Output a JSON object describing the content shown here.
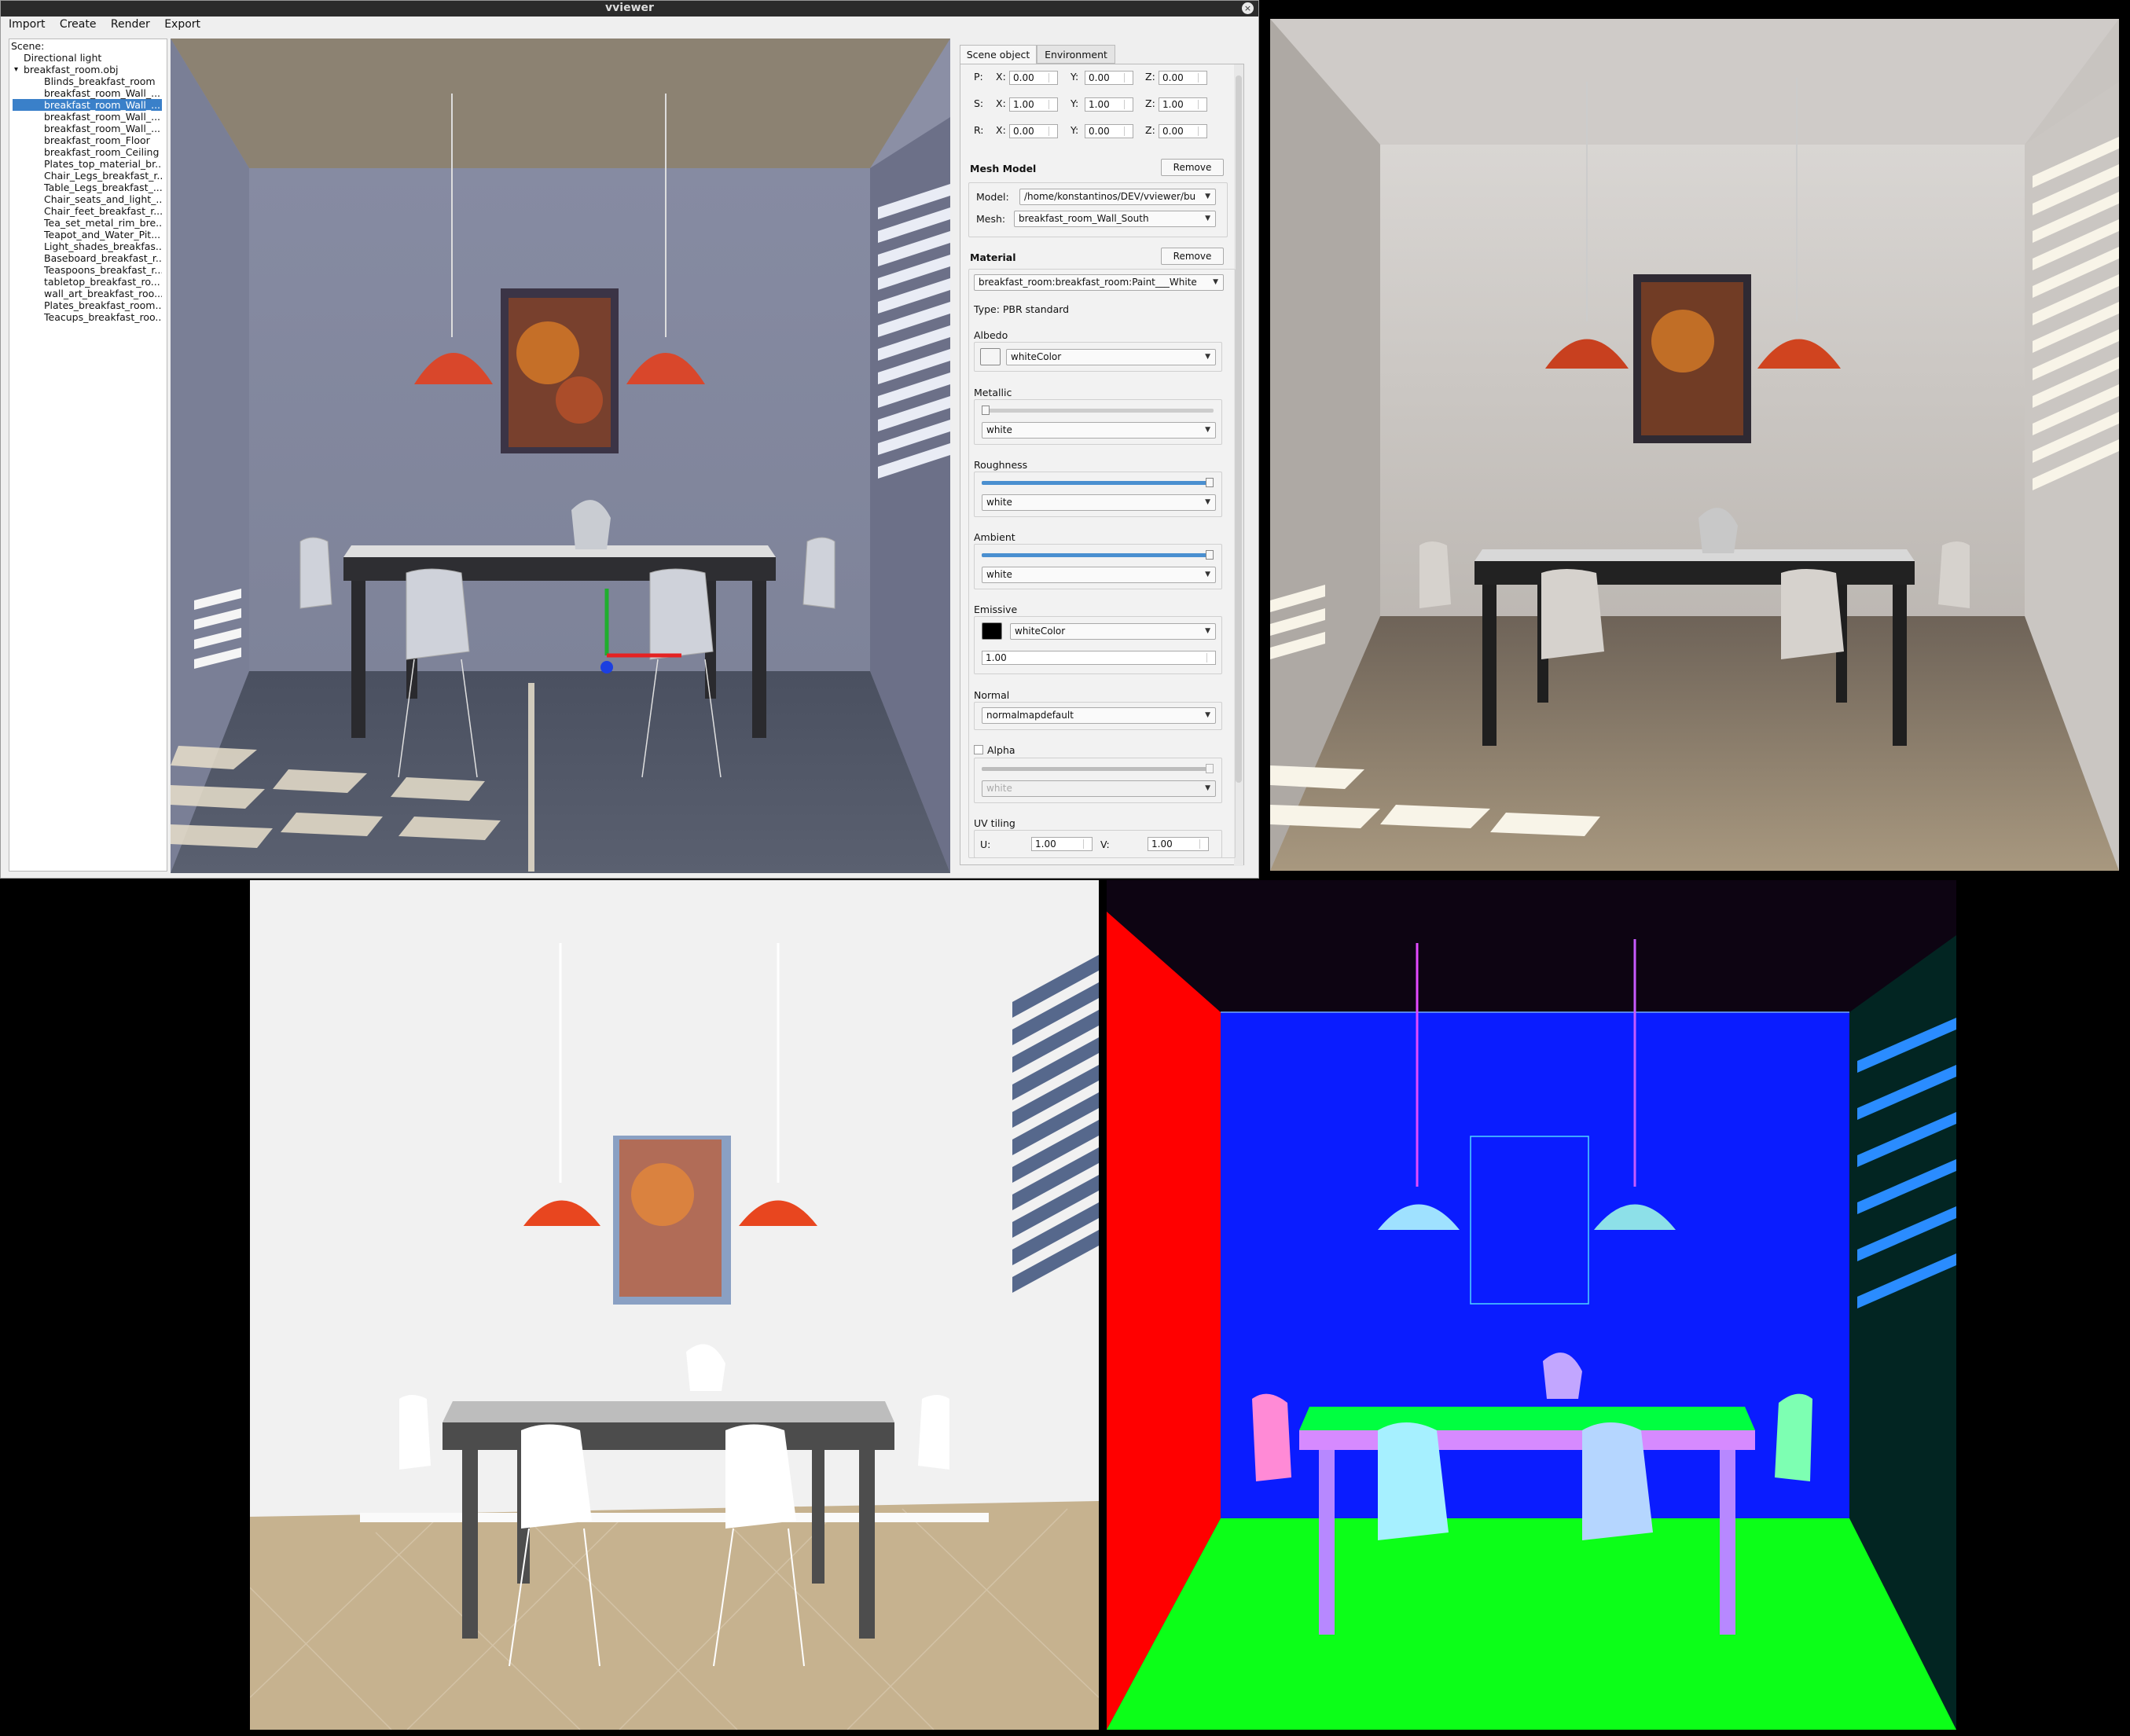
{
  "window": {
    "title": "vviewer",
    "close_glyph": "×"
  },
  "menu": [
    "Import",
    "Create",
    "Render",
    "Export"
  ],
  "scene_tree": {
    "header": "Scene:",
    "items": [
      {
        "label": "Directional light",
        "level": 1
      },
      {
        "label": "breakfast_room.obj",
        "level": 1,
        "expanded": true
      },
      {
        "label": "Blinds_breakfast_room",
        "level": 2
      },
      {
        "label": "breakfast_room_Wall_...",
        "level": 2
      },
      {
        "label": "breakfast_room_Wall_...",
        "level": 2,
        "selected": true
      },
      {
        "label": "breakfast_room_Wall_...",
        "level": 2
      },
      {
        "label": "breakfast_room_Wall_...",
        "level": 2
      },
      {
        "label": "breakfast_room_Floor",
        "level": 2
      },
      {
        "label": "breakfast_room_Ceiling",
        "level": 2
      },
      {
        "label": "Plates_top_material_br...",
        "level": 2
      },
      {
        "label": "Chair_Legs_breakfast_r...",
        "level": 2
      },
      {
        "label": "Table_Legs_breakfast_...",
        "level": 2
      },
      {
        "label": "Chair_seats_and_light_...",
        "level": 2
      },
      {
        "label": "Chair_feet_breakfast_r...",
        "level": 2
      },
      {
        "label": "Tea_set_metal_rim_bre...",
        "level": 2
      },
      {
        "label": "Teapot_and_Water_Pit...",
        "level": 2
      },
      {
        "label": "Light_shades_breakfas...",
        "level": 2
      },
      {
        "label": "Baseboard_breakfast_r...",
        "level": 2
      },
      {
        "label": "Teaspoons_breakfast_r...",
        "level": 2
      },
      {
        "label": "tabletop_breakfast_ro...",
        "level": 2
      },
      {
        "label": "wall_art_breakfast_roo...",
        "level": 2
      },
      {
        "label": "Plates_breakfast_room...",
        "level": 2
      },
      {
        "label": "Teacups_breakfast_roo...",
        "level": 2
      }
    ]
  },
  "panel": {
    "tabs": [
      "Scene object",
      "Environment"
    ],
    "transform": [
      {
        "label": "P:",
        "x": "0.00",
        "y": "0.00",
        "z": "0.00"
      },
      {
        "label": "S:",
        "x": "1.00",
        "y": "1.00",
        "z": "1.00"
      },
      {
        "label": "R:",
        "x": "0.00",
        "y": "0.00",
        "z": "0.00"
      }
    ],
    "axis_labels": {
      "x": "X:",
      "y": "Y:",
      "z": "Z:"
    },
    "mesh_model": {
      "title": "Mesh Model",
      "remove": "Remove",
      "model_label": "Model:",
      "model_value": "/home/konstantinos/DEV/vviewer/bu",
      "mesh_label": "Mesh:",
      "mesh_value": "breakfast_room_Wall_South"
    },
    "material": {
      "title": "Material",
      "remove": "Remove",
      "name": "breakfast_room:breakfast_room:Paint___White",
      "type": "Type: PBR standard",
      "albedo": {
        "label": "Albedo",
        "texture": "whiteColor",
        "color": "#f5f5f5"
      },
      "metallic": {
        "label": "Metallic",
        "value": 0.0,
        "texture": "white"
      },
      "roughness": {
        "label": "Roughness",
        "value": 1.0,
        "texture": "white"
      },
      "ambient": {
        "label": "Ambient",
        "value": 1.0,
        "texture": "white"
      },
      "emissive": {
        "label": "Emissive",
        "texture": "whiteColor",
        "color": "#000000",
        "strength": "1.00"
      },
      "normal": {
        "label": "Normal",
        "texture": "normalmapdefault"
      },
      "alpha": {
        "label": "Alpha",
        "checked": false,
        "value": 1.0,
        "texture": "white"
      },
      "uv_tiling": {
        "label": "UV tiling",
        "u_label": "U:",
        "u": "1.00",
        "v_label": "V:",
        "v": "1.00"
      }
    }
  },
  "colors": {
    "accent": "#3a80c9",
    "lamp_orange": "#d9472b",
    "normal_wall_blue": "#0a1cff",
    "normal_floor_green": "#0cff18",
    "normal_side_red": "#ff0000"
  }
}
